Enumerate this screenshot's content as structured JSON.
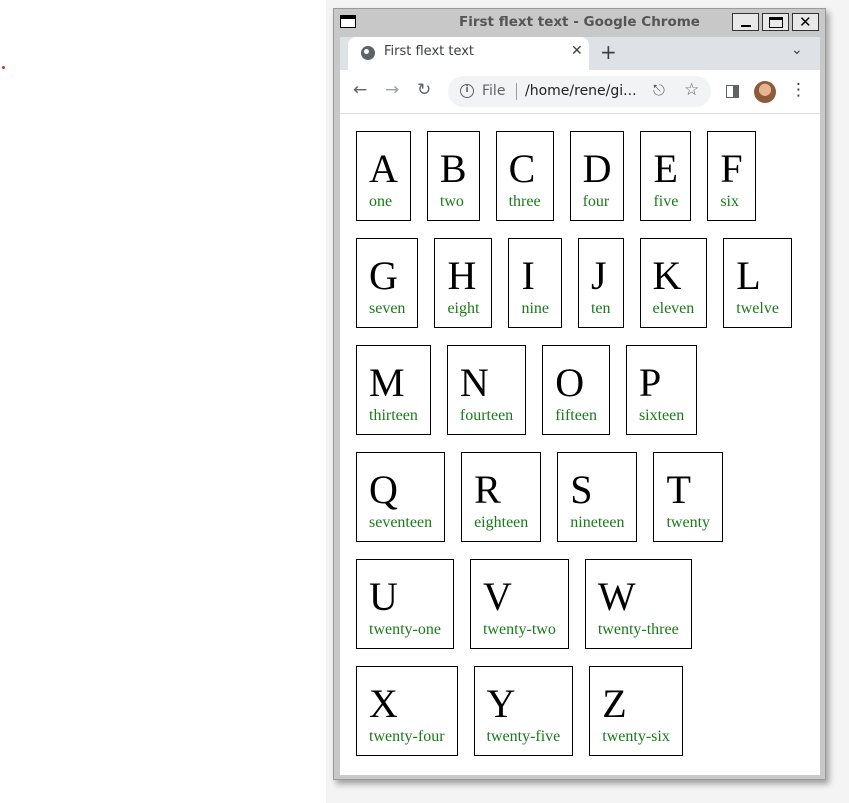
{
  "window": {
    "title": "First flext text - Google Chrome"
  },
  "browser": {
    "tab_title": "First flext text",
    "tab_close": "✕",
    "new_tab": "+",
    "tab_menu": "⌄",
    "omnibox": {
      "scheme": "File",
      "url": "/home/rene/gi..."
    }
  },
  "icons": {
    "back": "←",
    "forward": "→",
    "reload": "↻",
    "share": "⎋",
    "star": "☆",
    "menu": "⋮",
    "info": "i",
    "close": "✕"
  },
  "items": [
    {
      "letter": "A",
      "word": "one"
    },
    {
      "letter": "B",
      "word": "two"
    },
    {
      "letter": "C",
      "word": "three"
    },
    {
      "letter": "D",
      "word": "four"
    },
    {
      "letter": "E",
      "word": "five"
    },
    {
      "letter": "F",
      "word": "six"
    },
    {
      "letter": "G",
      "word": "seven"
    },
    {
      "letter": "H",
      "word": "eight"
    },
    {
      "letter": "I",
      "word": "nine"
    },
    {
      "letter": "J",
      "word": "ten"
    },
    {
      "letter": "K",
      "word": "eleven"
    },
    {
      "letter": "L",
      "word": "twelve"
    },
    {
      "letter": "M",
      "word": "thirteen"
    },
    {
      "letter": "N",
      "word": "fourteen"
    },
    {
      "letter": "O",
      "word": "fifteen"
    },
    {
      "letter": "P",
      "word": "sixteen"
    },
    {
      "letter": "Q",
      "word": "seventeen"
    },
    {
      "letter": "R",
      "word": "eighteen"
    },
    {
      "letter": "S",
      "word": "nineteen"
    },
    {
      "letter": "T",
      "word": "twenty"
    },
    {
      "letter": "U",
      "word": "twenty-one"
    },
    {
      "letter": "V",
      "word": "twenty-two"
    },
    {
      "letter": "W",
      "word": "twenty-three"
    },
    {
      "letter": "X",
      "word": "twenty-four"
    },
    {
      "letter": "Y",
      "word": "twenty-five"
    },
    {
      "letter": "Z",
      "word": "twenty-six"
    }
  ]
}
